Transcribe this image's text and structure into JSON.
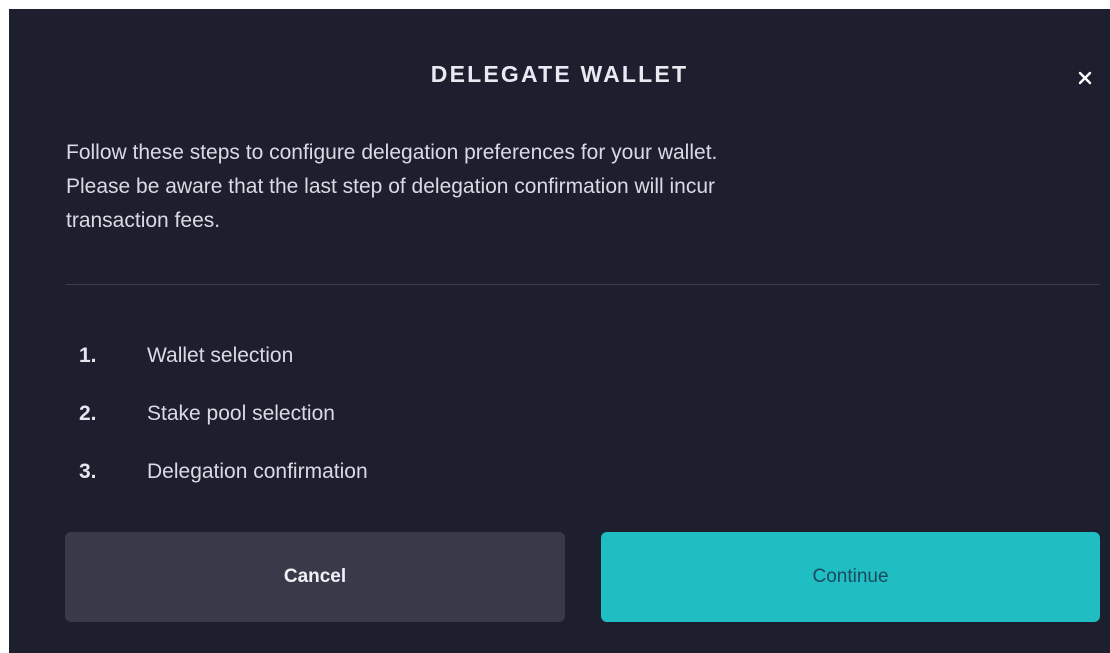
{
  "dialog": {
    "title": "DELEGATE WALLET",
    "close_icon": "close-icon",
    "intro_line1": "Follow these steps to configure delegation preferences for your wallet.",
    "intro_line2": "Please be aware that the last step of delegation confirmation will incur",
    "intro_line3": "transaction fees.",
    "steps": [
      {
        "number": "1.",
        "label": "Wallet selection"
      },
      {
        "number": "2.",
        "label": "Stake pool selection"
      },
      {
        "number": "3.",
        "label": "Delegation confirmation"
      }
    ],
    "cancel_label": "Cancel",
    "continue_label": "Continue"
  },
  "colors": {
    "dialog_background": "#1e1f2e",
    "cancel_button": "#393a49",
    "continue_button": "#1ebec3",
    "continue_text": "#1c4a5e"
  }
}
